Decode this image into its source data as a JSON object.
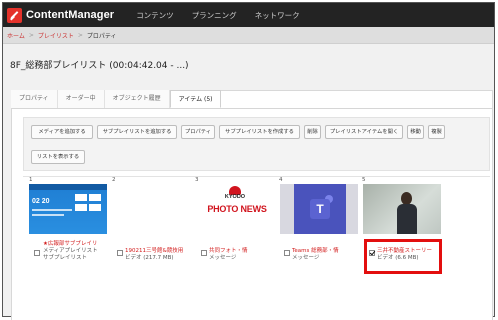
{
  "app": {
    "name": "ContentManager"
  },
  "nav": {
    "items": [
      "コンテンツ",
      "プランニング",
      "ネットワーク"
    ]
  },
  "breadcrumb": {
    "items": [
      "ホーム",
      "プレイリスト",
      "プロパティ"
    ]
  },
  "page": {
    "title": "8F_総務部プレイリスト (00:04:42.04 - ...)"
  },
  "tabs": [
    {
      "label": "プロパティ",
      "active": false
    },
    {
      "label": "オーダー中",
      "active": false
    },
    {
      "label": "オブジェクト履歴",
      "active": false
    },
    {
      "label": "アイテム (5)",
      "active": true
    }
  ],
  "toolbar": {
    "buttons": [
      "メディアを追加する",
      "サブプレイリストを追加する",
      "プロパティ",
      "サブプレイリストを作成する",
      "削除",
      "プレイリストアイテムを開く",
      "移動",
      "複製"
    ],
    "show_list": "リストを表示する"
  },
  "items": [
    {
      "number": "1",
      "title": "★広報部サブプレイリ",
      "subtitle": "メディアプレイリスト",
      "type": "サブプレイリスト",
      "checked": false,
      "thumb_text": "02 20"
    },
    {
      "number": "2",
      "title": "190211三号館&競技用",
      "type": "ビデオ (217.7 MB)",
      "checked": false
    },
    {
      "number": "3",
      "title": "共同フォト・情",
      "type": "メッセージ",
      "checked": false,
      "thumb_brand": "KYODO",
      "thumb_text": "PHOTO NEWS"
    },
    {
      "number": "4",
      "title": "Teams 総務部・情",
      "type": "メッセージ",
      "checked": false,
      "thumb_icon": "teams-icon"
    },
    {
      "number": "5",
      "title": "三井不動産ストーリー",
      "type": "ビデオ (6.6 MB)",
      "checked": true
    }
  ],
  "colors": {
    "accent_red": "#e30e0e",
    "link_red": "#d21b1b",
    "topbar": "#232323"
  }
}
